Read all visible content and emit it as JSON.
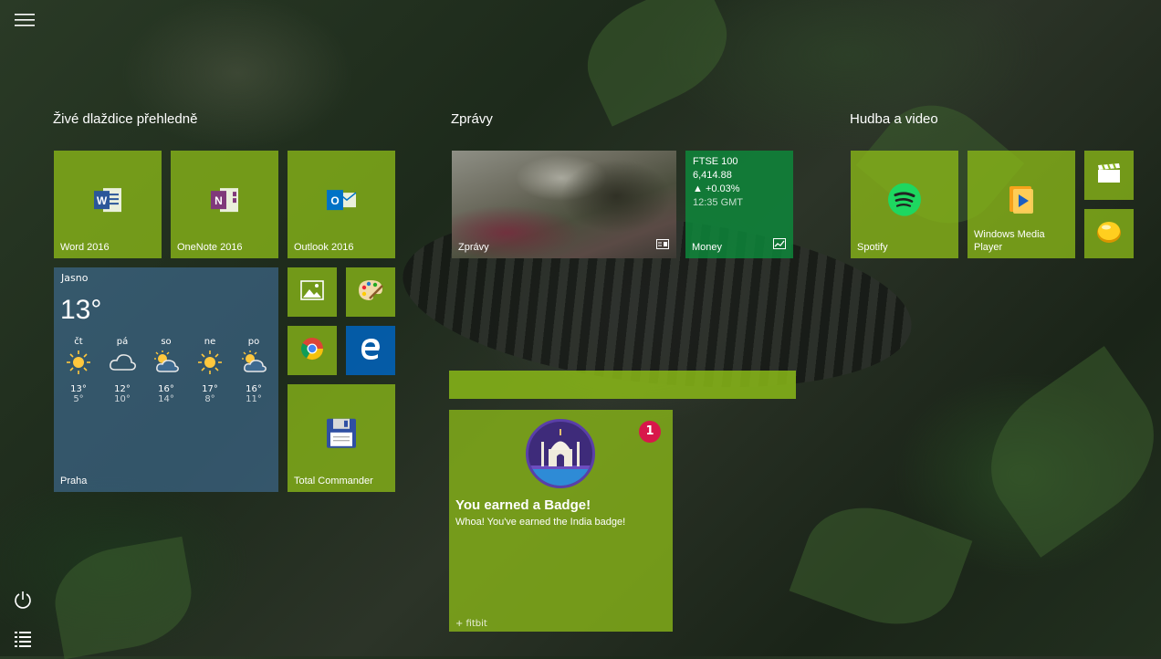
{
  "groups": {
    "live": "Živé dlaždice přehledně",
    "news": "Zprávy",
    "media": "Hudba a video"
  },
  "tiles": {
    "word": "Word 2016",
    "onenote": "OneNote 2016",
    "outlook": "Outlook 2016",
    "total_commander": "Total Commander",
    "news": "Zprávy",
    "money": "Money",
    "spotify": "Spotify",
    "wmp_line1": "Windows Media",
    "wmp_line2": "Player"
  },
  "weather": {
    "condition": "Jasno",
    "temperature": "13°",
    "city": "Praha",
    "days": [
      {
        "name": "čt",
        "icon": "sun-icon",
        "hi": "13°",
        "lo": "5°"
      },
      {
        "name": "pá",
        "icon": "cloud-icon",
        "hi": "12°",
        "lo": "10°"
      },
      {
        "name": "so",
        "icon": "partly-cloudy-icon",
        "hi": "16°",
        "lo": "14°"
      },
      {
        "name": "ne",
        "icon": "sun-icon",
        "hi": "17°",
        "lo": "8°"
      },
      {
        "name": "po",
        "icon": "partly-cloudy-icon",
        "hi": "16°",
        "lo": "11°"
      }
    ]
  },
  "money": {
    "index": "FTSE 100",
    "value": "6,414.88",
    "change": "▲ +0.03%",
    "time": "12:35 GMT"
  },
  "fitbit": {
    "count": "1",
    "title": "You earned a Badge!",
    "message": "Whoa! You've earned the India badge!",
    "brand": "+ fitbit"
  },
  "colors": {
    "tile_accent": "#8ab918",
    "money": "#0c8c3c",
    "weather": "#4678aa",
    "notification": "#d8174a"
  }
}
